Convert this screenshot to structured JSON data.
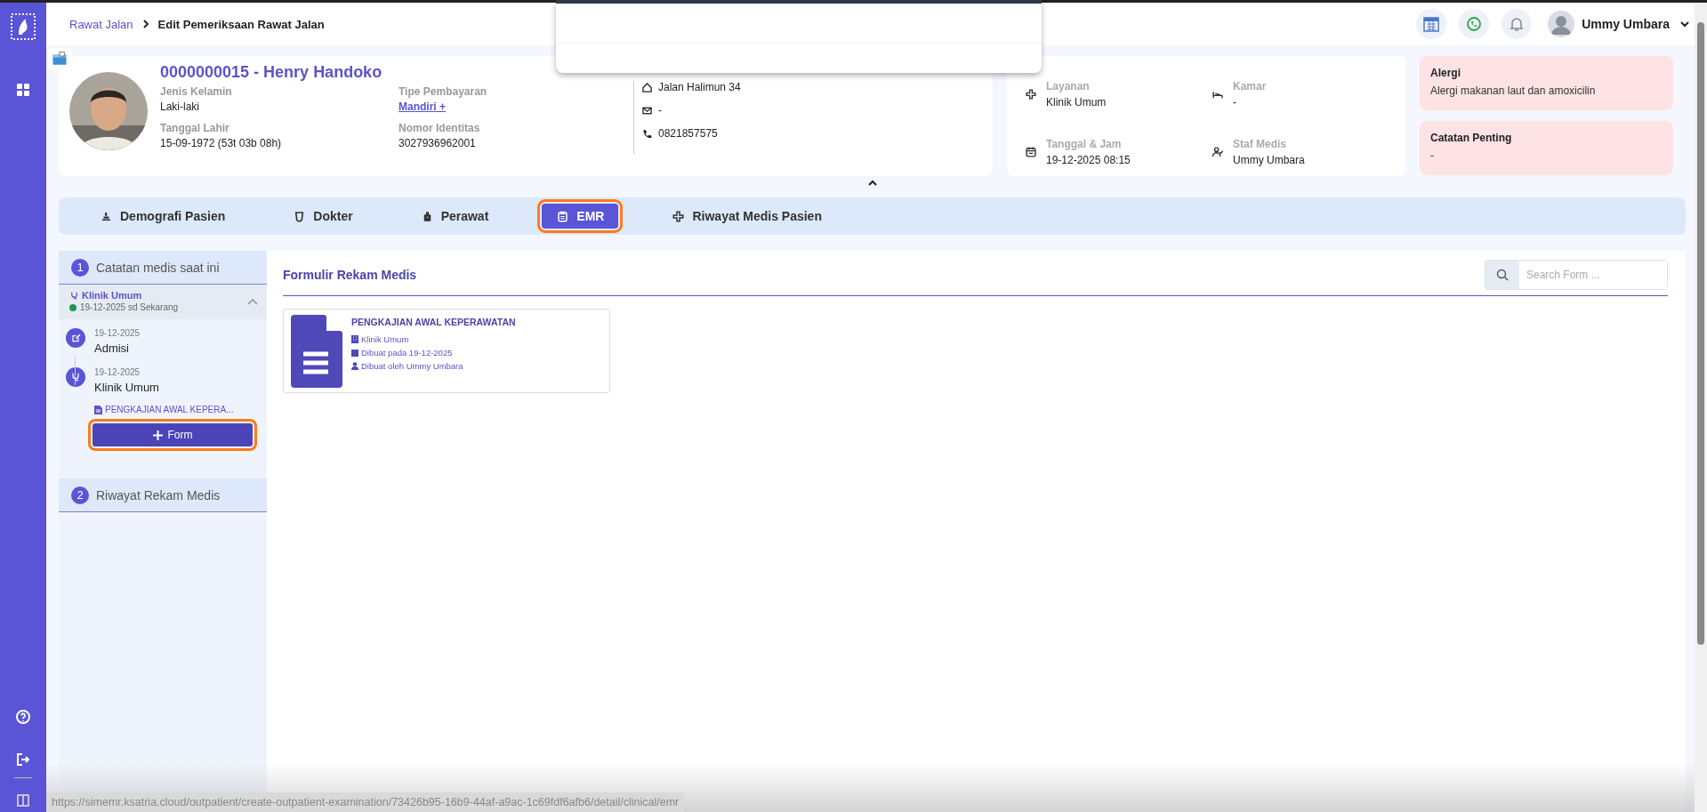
{
  "breadcrumb": [
    {
      "label": "Rawat Jalan"
    },
    {
      "label": "Edit Pemeriksaan Rawat Jalan"
    }
  ],
  "user": {
    "name": "Ummy Umbara"
  },
  "patient": {
    "title": "0000000015 - Henry Handoko",
    "fields": [
      {
        "label": "Jenis Kelamin",
        "value": "Laki-laki",
        "kind": "text"
      },
      {
        "label": "Tipe Pembayaran",
        "value": "Mandiri +",
        "kind": "link"
      },
      {
        "label": "Tanggal Lahir",
        "value": "15-09-1972 (53t 03b 08h)",
        "kind": "text"
      },
      {
        "label": "Nomor Identitas",
        "value": "3027936962001",
        "kind": "text"
      }
    ],
    "contacts": [
      {
        "kind": "address",
        "value": "Jalan Halimun 34"
      },
      {
        "kind": "email",
        "value": "-"
      },
      {
        "kind": "phone",
        "value": "0821857575"
      }
    ]
  },
  "visit": [
    {
      "kind": "service",
      "label": "Layanan",
      "value": "Klinik Umum"
    },
    {
      "kind": "room",
      "label": "Kamar",
      "value": "-"
    },
    {
      "kind": "datetime",
      "label": "Tanggal & Jam",
      "value": "19-12-2025 08:15"
    },
    {
      "kind": "staff",
      "label": "Staf Medis",
      "value": "Ummy Umbara"
    }
  ],
  "notes": [
    {
      "title": "Alergi",
      "text": "Alergi makanan laut dan amoxicilin"
    },
    {
      "title": "Catatan Penting",
      "text": "-"
    }
  ],
  "tabs": [
    {
      "label": "Demografi Pasien",
      "kind": "demography",
      "selected": false,
      "highlighted": false
    },
    {
      "label": "Dokter",
      "kind": "doctor",
      "selected": false,
      "highlighted": false
    },
    {
      "label": "Perawat",
      "kind": "nurse",
      "selected": false,
      "highlighted": false
    },
    {
      "label": "EMR",
      "kind": "emr",
      "selected": true,
      "highlighted": true
    },
    {
      "label": "Riwayat Medis Pasien",
      "kind": "history",
      "selected": false,
      "highlighted": false
    }
  ],
  "current_records": {
    "number": "1",
    "title": "Catatan medis saat ini",
    "visit": {
      "name": "Klinik Umum",
      "period": "19-12-2025 sd Sekarang",
      "expanded": true
    },
    "timeline": [
      {
        "kind": "admission",
        "date": "19-12-2025",
        "title": "Admisi"
      },
      {
        "kind": "clinic",
        "date": "19-12-2025",
        "title": "Klinik Umum",
        "document": "PENGKAJIAN AWAL KEPERA..."
      }
    ],
    "add_button": {
      "label": "Form",
      "highlighted": true
    }
  },
  "record_history": {
    "number": "2",
    "title": "Riwayat Rekam Medis"
  },
  "forms": {
    "title": "Formulir Rekam Medis",
    "search": {
      "placeholder": "Search Form ..."
    },
    "cards": [
      {
        "title": "PENGKAJIAN AWAL KEPERAWATAN",
        "clinic": "Klinik Umum",
        "created": "Dibuat pada 19-12-2025",
        "author": "Dibuat oleh Ummy Umbara"
      }
    ]
  },
  "status_url": "https://simemr.ksatria.cloud/outpatient/create-outpatient-examination/73426b95-16b9-44af-a9ac-1c69fdf6afb6/detail/clinical/emr"
}
